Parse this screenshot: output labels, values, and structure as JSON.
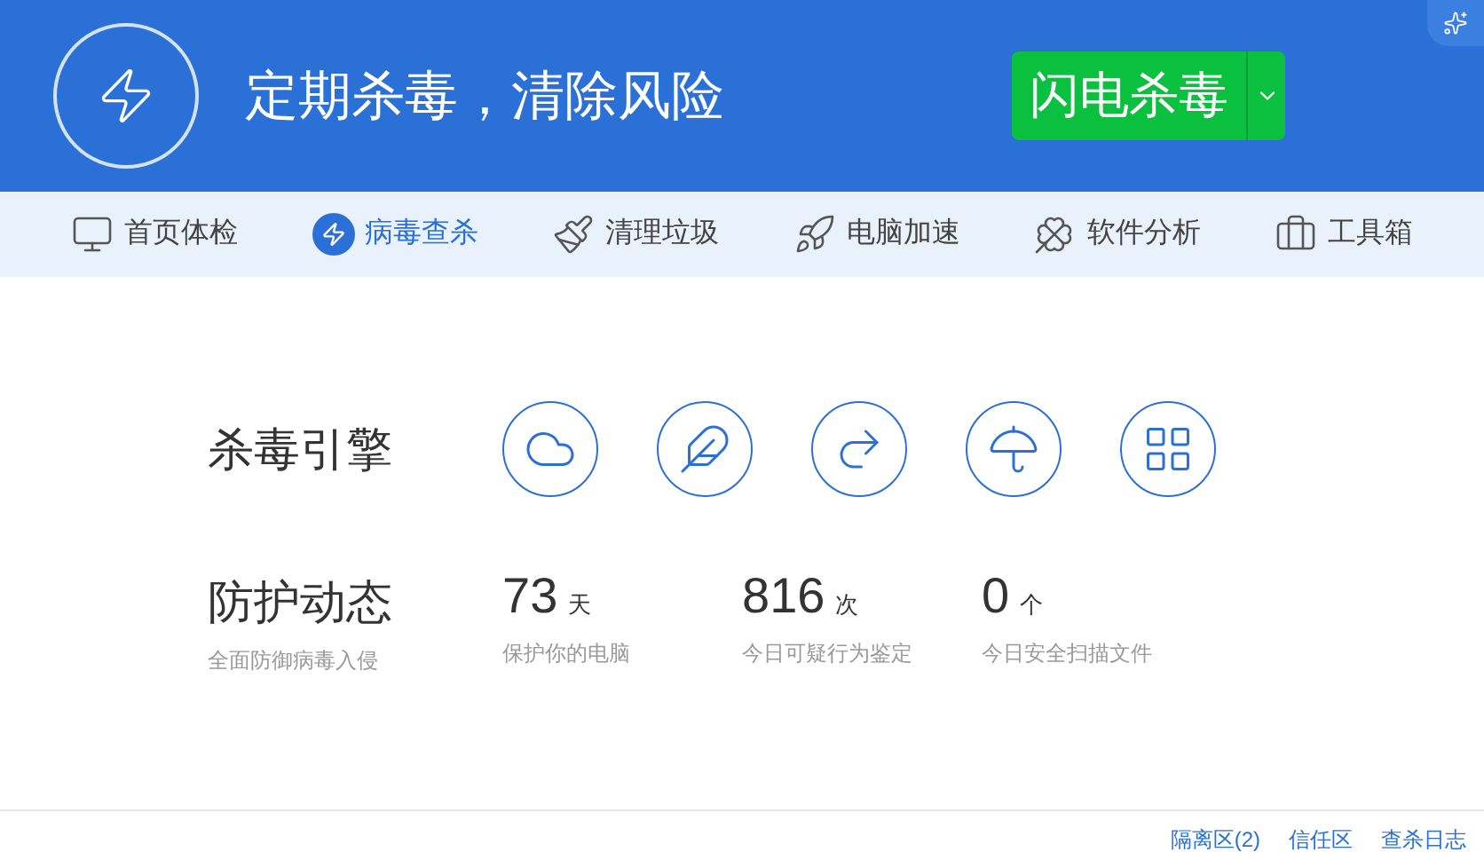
{
  "header": {
    "slogan": "定期杀毒，清除风险",
    "scan_button": "闪电杀毒"
  },
  "tabs": [
    {
      "label": "首页体检",
      "selected": false
    },
    {
      "label": "病毒查杀",
      "selected": true
    },
    {
      "label": "清理垃圾",
      "selected": false
    },
    {
      "label": "电脑加速",
      "selected": false
    },
    {
      "label": "软件分析",
      "selected": false
    },
    {
      "label": "工具箱",
      "selected": false
    }
  ],
  "engines": {
    "title": "杀毒引擎"
  },
  "protection": {
    "title": "防护动态",
    "subtitle": "全面防御病毒入侵",
    "stats": [
      {
        "value": "73",
        "unit": "天",
        "caption": "保护你的电脑"
      },
      {
        "value": "816",
        "unit": "次",
        "caption": "今日可疑行为鉴定"
      },
      {
        "value": "0",
        "unit": "个",
        "caption": "今日安全扫描文件"
      }
    ]
  },
  "footer_links": [
    "隔离区(2)",
    "信任区",
    "查杀日志"
  ]
}
